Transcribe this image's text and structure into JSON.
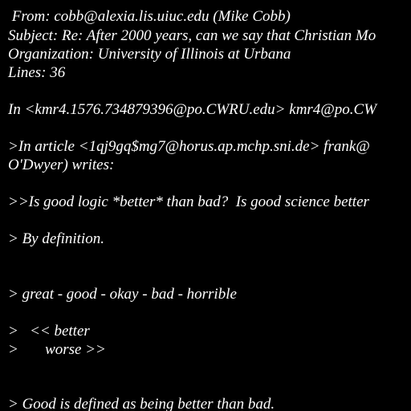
{
  "background_color": "#000000",
  "text_color": "#ffffff",
  "header": {
    "from": " From: cobb@alexia.lis.uiuc.edu (Mike Cobb)",
    "subject": "Subject: Re: After 2000 years, can we say that Christian Mo",
    "organization": "Organization: University of Illinois at Urbana",
    "lines": "Lines: 36"
  },
  "body": {
    "attribution": "In <kmr4.1576.734879396@po.CWRU.edu> kmr4@po.CW",
    "quote_attribution_1": ">In article <1qj9gq$mg7@horus.ap.mchp.sni.de> frank@",
    "quote_attribution_2": "O'Dwyer) writes:",
    "quote_question": ">>Is good logic *better* than bad?  Is good science better",
    "reply_definition": "> By definition.",
    "scale": "> great - good - okay - bad - horrible",
    "arrow_better": ">   << better",
    "arrow_worse": ">       worse >>",
    "defined": "> Good is defined as being better than bad."
  }
}
